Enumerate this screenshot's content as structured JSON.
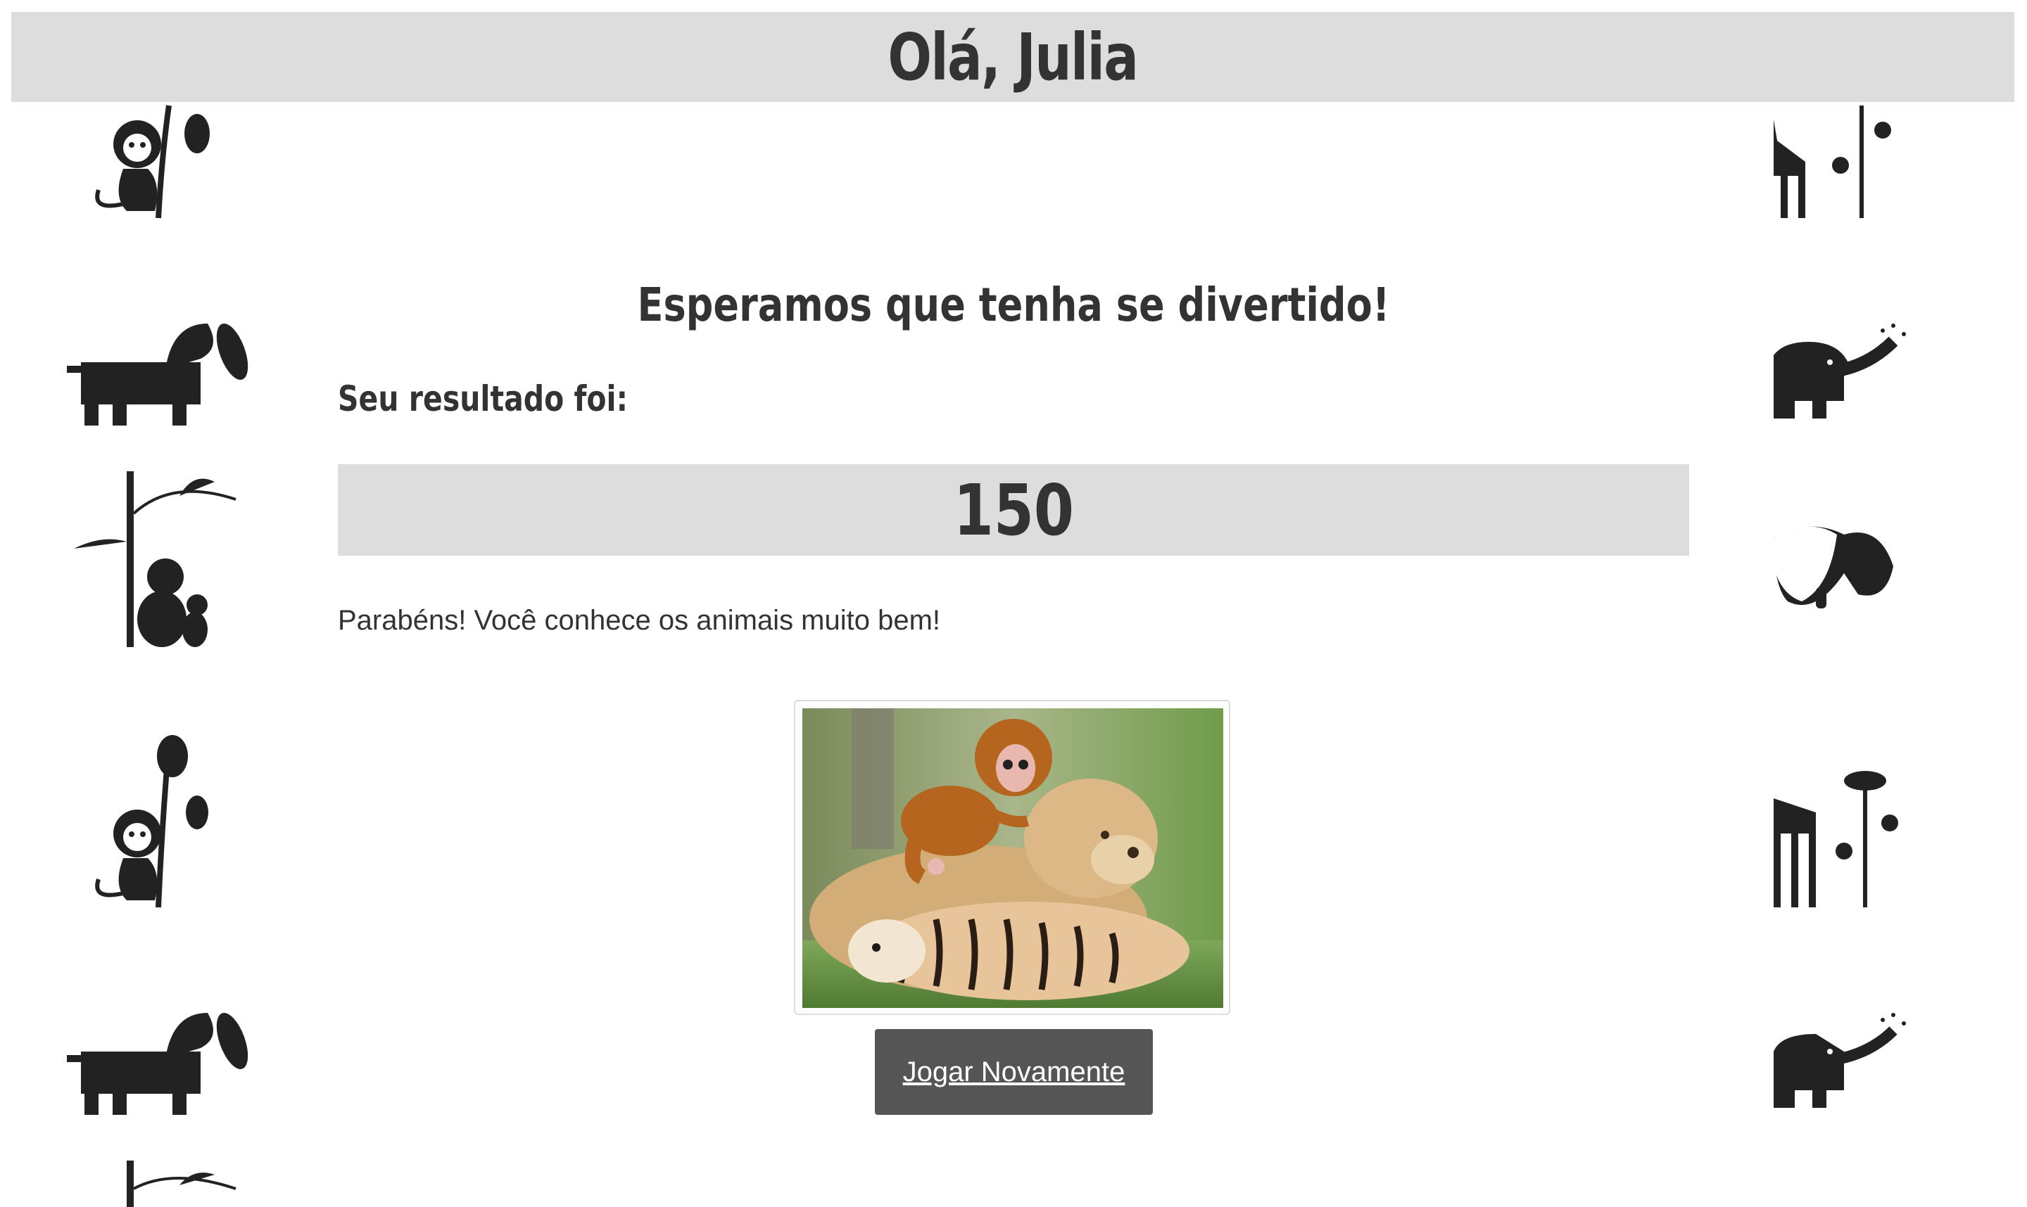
{
  "header": {
    "greeting": "Olá, Julia"
  },
  "main": {
    "subtitle": "Esperamos que tenha se divertido!",
    "result_label": "Seu resultado foi:",
    "score": "150",
    "message": "Parabéns! Você conhece os animais muito bem!",
    "photo": {
      "icon": "animals-photo"
    },
    "play_again_label": "Jogar Novamente"
  },
  "background": {
    "icons": [
      "monkey-icon",
      "dog-icon",
      "koala-icon",
      "elephant-icon",
      "giraffe-icon",
      "dinosaur-icon"
    ]
  },
  "colors": {
    "header_bg": "#dddddd",
    "text": "#333333",
    "button_bg": "#555555",
    "icon": "#222222"
  }
}
